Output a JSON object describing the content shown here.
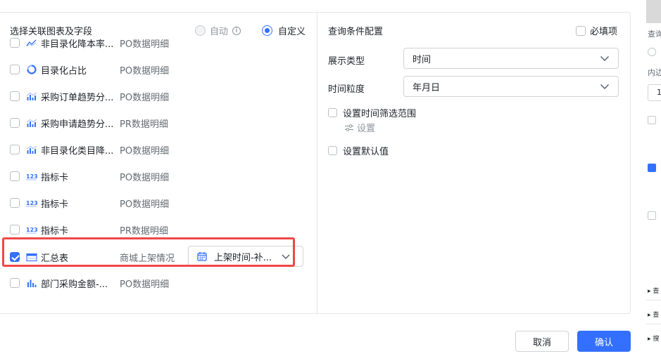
{
  "left_panel": {
    "title": "选择关联图表及字段",
    "mode_options": [
      {
        "label": "自动",
        "selected": false,
        "disabled": true
      },
      {
        "label": "自定义",
        "selected": true
      }
    ],
    "info_icon": "info-icon",
    "rows": [
      {
        "icon": "line-chart-icon",
        "name": "非目录化降本率...",
        "source": "PO数据明细",
        "checked": false
      },
      {
        "icon": "ring-chart-icon",
        "name": "目录化占比",
        "source": "PO数据明细",
        "checked": false
      },
      {
        "icon": "bar-line-chart-icon",
        "name": "采购订单趋势分...",
        "source": "PO数据明细",
        "checked": false
      },
      {
        "icon": "bar-line-chart-icon",
        "name": "采购申请趋势分...",
        "source": "PR数据明细",
        "checked": false
      },
      {
        "icon": "bar-line-chart-icon",
        "name": "非目录化类目降...",
        "source": "PO数据明细",
        "checked": false
      },
      {
        "icon": "number-card-icon",
        "name": "指标卡",
        "source": "PO数据明细",
        "checked": false
      },
      {
        "icon": "number-card-icon",
        "name": "指标卡",
        "source": "PO数据明细",
        "checked": false
      },
      {
        "icon": "number-card-icon",
        "name": "指标卡",
        "source": "PR数据明细",
        "checked": false
      },
      {
        "icon": "table-icon",
        "name": "汇总表",
        "source": "商城上架情况",
        "checked": true,
        "field": "上架时间-补..."
      },
      {
        "icon": "bar-chart-icon",
        "name": "部门采购金额-...",
        "source": "PO数据明细",
        "checked": false
      }
    ]
  },
  "right_panel": {
    "title": "查询条件配置",
    "required_label": "必填项",
    "display_type_label": "展示类型",
    "display_type_value": "时间",
    "granularity_label": "时间粒度",
    "granularity_value": "年月日",
    "range_option_label": "设置时间筛选范围",
    "setting_link": "设置",
    "default_option_label": "设置默认值"
  },
  "footer": {
    "cancel_label": "取消",
    "confirm_label": "确认"
  },
  "background": {
    "texts": [
      "查询",
      "内边",
      "1"
    ],
    "tree_items": [
      "查",
      "查",
      "搜"
    ]
  },
  "colors": {
    "accent": "#3370ff",
    "highlight": "#f04747"
  }
}
